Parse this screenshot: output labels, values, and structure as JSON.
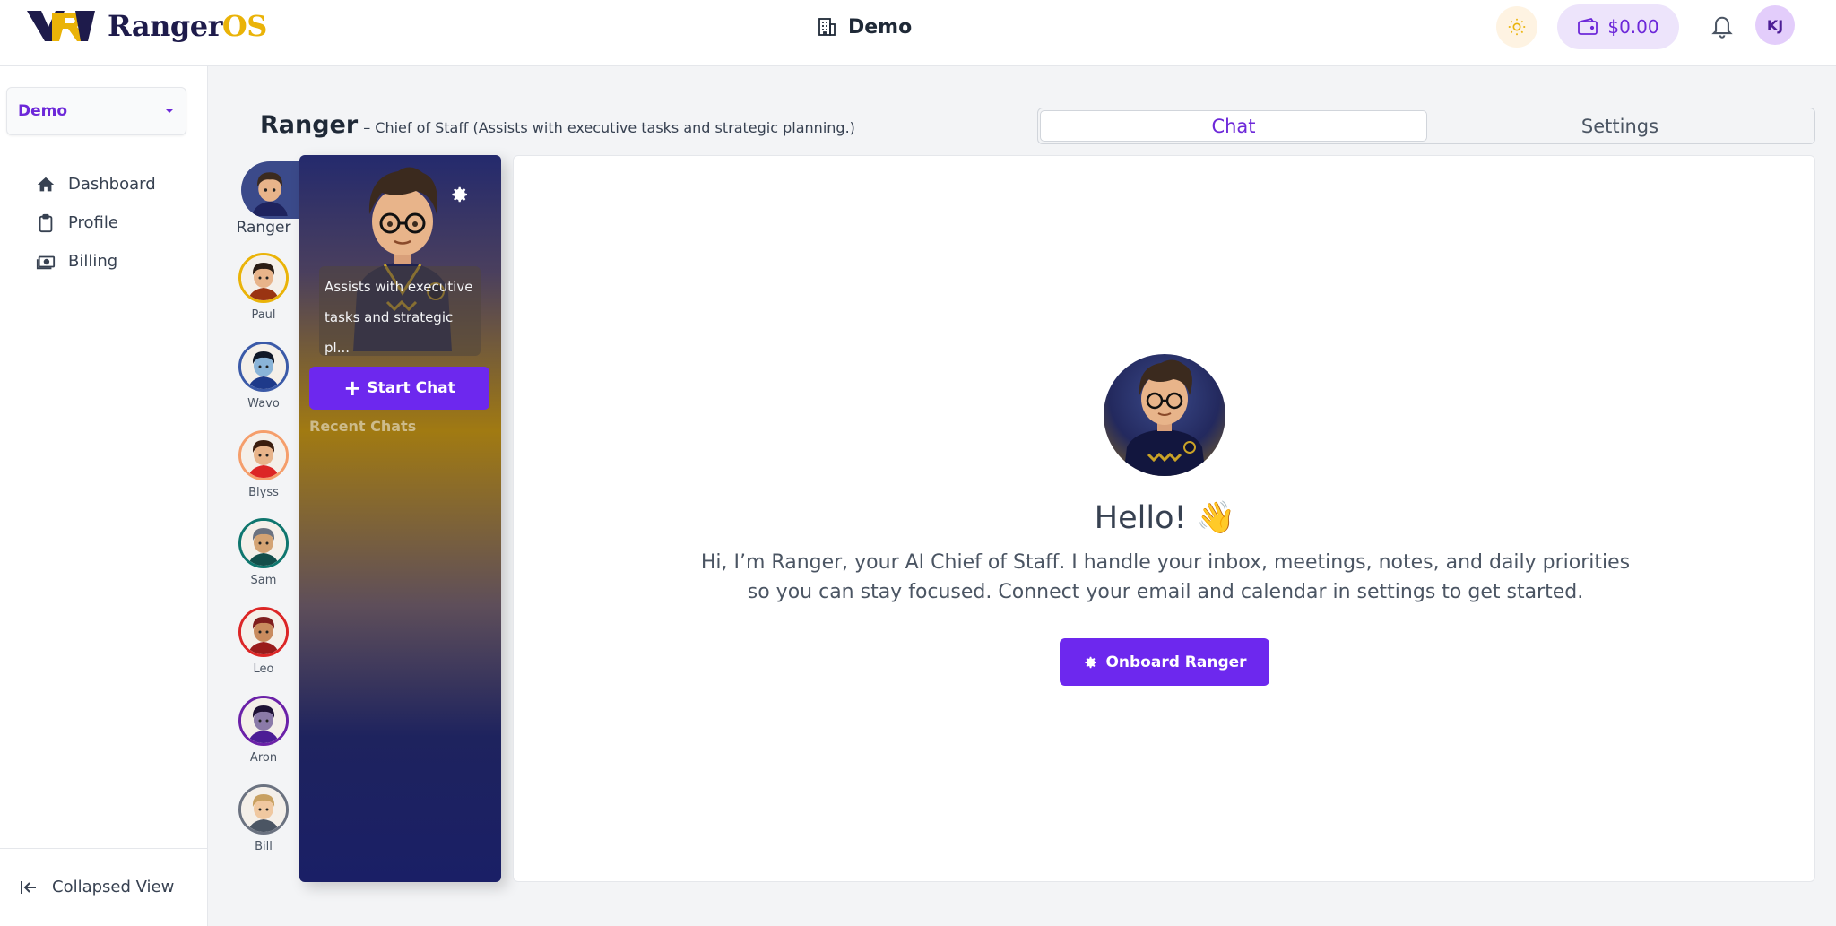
{
  "brand": {
    "name_part1": "Ranger",
    "name_part2": "OS"
  },
  "header": {
    "workspace_title": "Demo",
    "wallet_balance": "$0.00",
    "user_initials": "KJ",
    "colors": {
      "accent": "#6d28ee",
      "wallet_bg": "#ede4fb",
      "avatar_bg": "#e3cdfb"
    }
  },
  "sidebar": {
    "workspace_select": "Demo",
    "items": [
      {
        "label": "Dashboard",
        "icon": "home-icon"
      },
      {
        "label": "Profile",
        "icon": "clipboard-icon"
      },
      {
        "label": "Billing",
        "icon": "money-icon"
      }
    ],
    "collapse_label": "Collapsed View"
  },
  "agent": {
    "name": "Ranger",
    "role_line": "– Chief of Staff  (Assists with executive tasks and strategic planning.)",
    "card_description": "Assists with executive tasks and strategic pl...",
    "start_chat_label": "Start Chat",
    "recent_chats_label": "Recent Chats"
  },
  "tabs": [
    {
      "label": "Chat",
      "active": true
    },
    {
      "label": "Settings",
      "active": false
    }
  ],
  "agents": [
    {
      "name": "Ranger",
      "ring": "#3b4a8a",
      "skin": "#e8b48a",
      "hair": "#3b2a1e",
      "shirt": "#1e235e"
    },
    {
      "name": "Paul",
      "ring": "#eab308",
      "skin": "#e8b48a",
      "hair": "#2b1d14",
      "shirt": "#9a3412"
    },
    {
      "name": "Wavo",
      "ring": "#3b5aa8",
      "skin": "#8ab4d8",
      "hair": "#111827",
      "shirt": "#1e3a8a"
    },
    {
      "name": "Blyss",
      "ring": "#f59e6b",
      "skin": "#e8b48a",
      "hair": "#3b1d0e",
      "shirt": "#dc2626"
    },
    {
      "name": "Sam",
      "ring": "#0f766e",
      "skin": "#d4a373",
      "hair": "#6b7280",
      "shirt": "#134e4a"
    },
    {
      "name": "Leo",
      "ring": "#dc2626",
      "skin": "#c98b5e",
      "hair": "#7f1d1d",
      "shirt": "#991b1b"
    },
    {
      "name": "Aron",
      "ring": "#6b21a8",
      "skin": "#8b7aa8",
      "hair": "#1f1235",
      "shirt": "#4c1d95"
    },
    {
      "name": "Bill",
      "ring": "#6b7280",
      "skin": "#f0c8a0",
      "hair": "#c8a060",
      "shirt": "#4b5563"
    }
  ],
  "chat": {
    "hello": "Hello! 👋",
    "intro": "Hi, I’m Ranger, your AI Chief of Staff. I handle your inbox, meetings, notes, and daily priorities so you can stay focused. Connect your email and calendar in settings to get started.",
    "onboard_label": "Onboard Ranger"
  }
}
